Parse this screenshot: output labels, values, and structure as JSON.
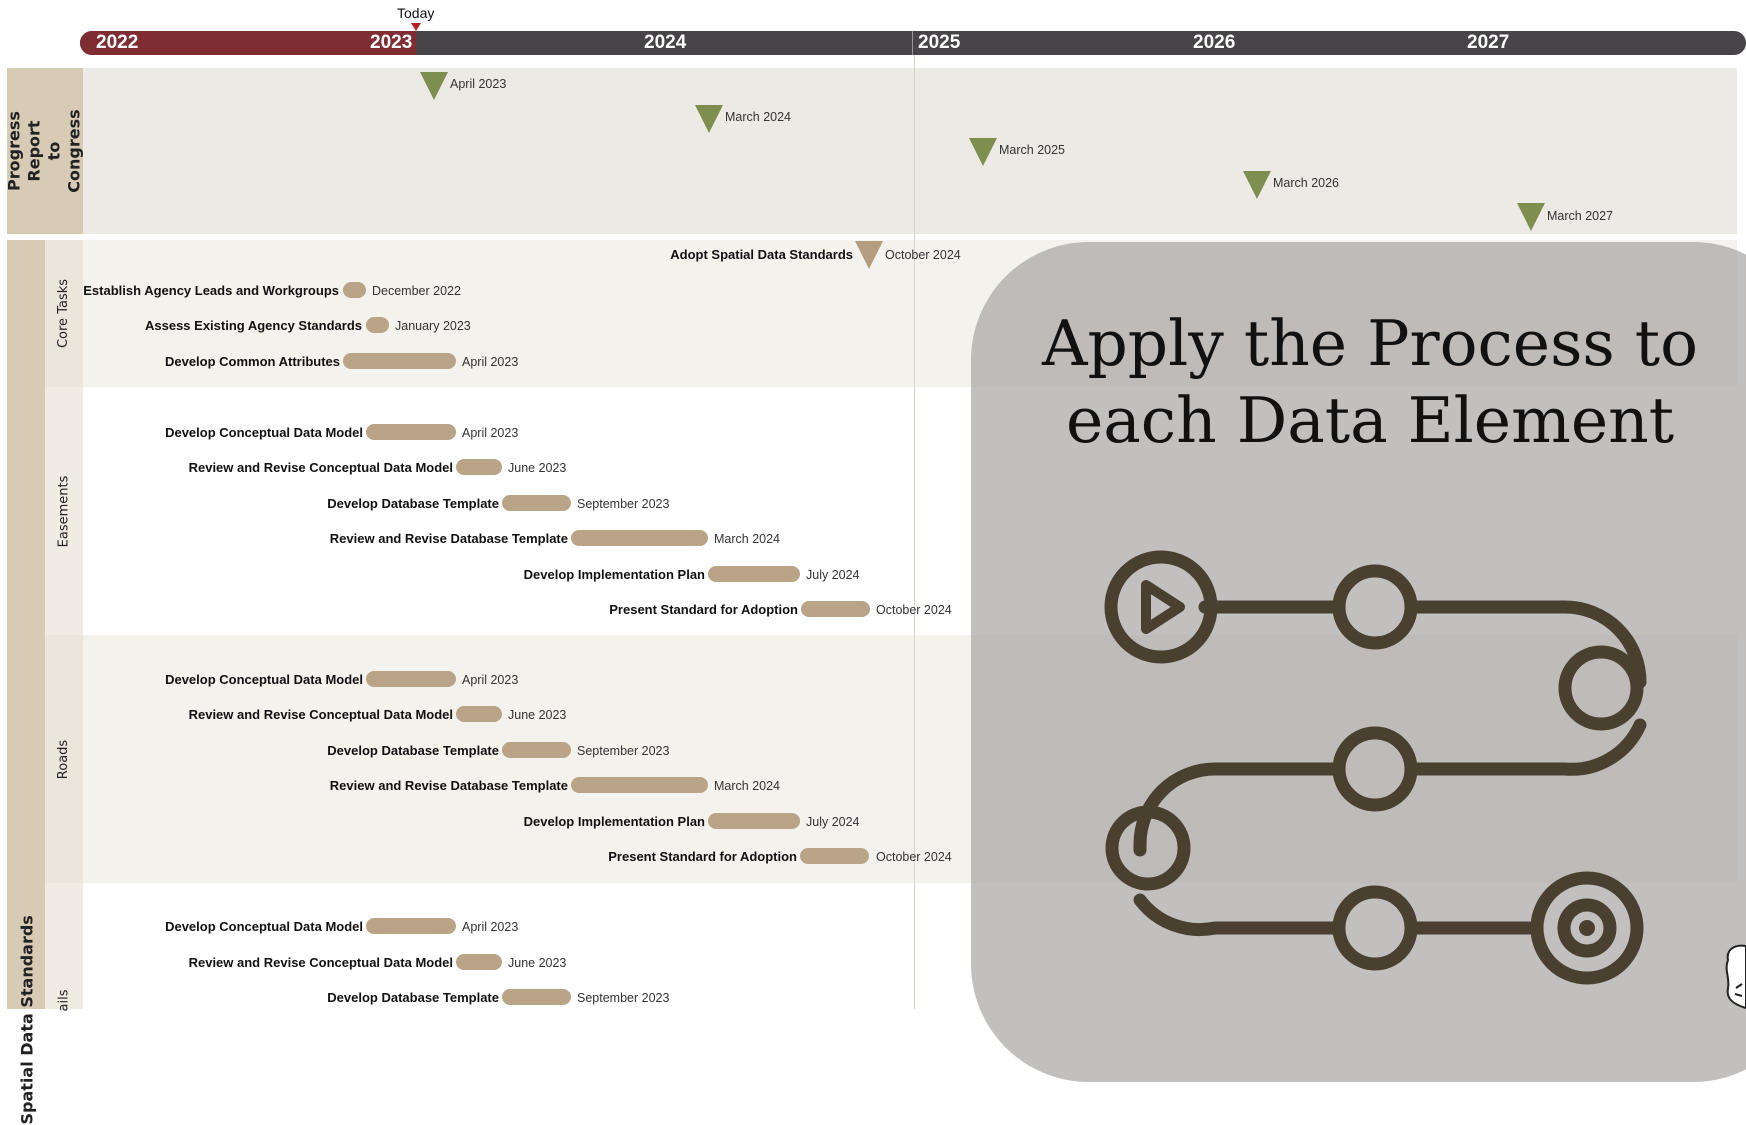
{
  "today": {
    "label": "Today"
  },
  "timeline": {
    "years": [
      "2022",
      "2023",
      "2024",
      "2025",
      "2026",
      "2027"
    ],
    "past_color": "#7f2d33",
    "future_color": "#464446"
  },
  "lanes": {
    "progress_report": {
      "label": "Progress Report to Congress",
      "milestones": [
        {
          "date": "April 2023"
        },
        {
          "date": "March 2024"
        },
        {
          "date": "March 2025"
        },
        {
          "date": "March 2026"
        },
        {
          "date": "March 2027"
        }
      ]
    },
    "spatial_data_standards": {
      "label": "Spatial Data Standards",
      "core_tasks": {
        "label": "Core Tasks",
        "milestone": {
          "name": "Adopt Spatial Data Standards",
          "date": "October 2024"
        },
        "tasks": [
          {
            "name": "Establish Agency Leads and Workgroups",
            "date": "December 2022"
          },
          {
            "name": "Assess Existing Agency Standards",
            "date": "January 2023"
          },
          {
            "name": "Develop Common Attributes",
            "date": "April 2023"
          }
        ]
      },
      "easements": {
        "label": "Easements",
        "tasks": [
          {
            "name": "Develop Conceptual Data Model",
            "date": "April 2023"
          },
          {
            "name": "Review and Revise Conceptual Data Model",
            "date": "June 2023"
          },
          {
            "name": "Develop Database Template",
            "date": "September 2023"
          },
          {
            "name": "Review and Revise Database Template",
            "date": "March 2024"
          },
          {
            "name": "Develop Implementation Plan",
            "date": "July 2024"
          },
          {
            "name": "Present Standard for Adoption",
            "date": "October 2024"
          }
        ]
      },
      "roads": {
        "label": "Roads",
        "tasks": [
          {
            "name": "Develop Conceptual Data Model",
            "date": "April 2023"
          },
          {
            "name": "Review and Revise Conceptual Data Model",
            "date": "June 2023"
          },
          {
            "name": "Develop Database Template",
            "date": "September 2023"
          },
          {
            "name": "Review and Revise Database Template",
            "date": "March 2024"
          },
          {
            "name": "Develop Implementation Plan",
            "date": "July 2024"
          },
          {
            "name": "Present Standard for Adoption",
            "date": "October 2024"
          }
        ]
      },
      "trails": {
        "label": "ails",
        "tasks": [
          {
            "name": "Develop Conceptual Data Model",
            "date": "April 2023"
          },
          {
            "name": "Review and Revise Conceptual Data Model",
            "date": "June 2023"
          },
          {
            "name": "Develop Database Template",
            "date": "September 2023"
          }
        ]
      }
    }
  },
  "overlay": {
    "title_line1": "Apply the Process to",
    "title_line2": "each Data Element",
    "icon": "process-path-icon",
    "icon_color": "#4a4030"
  }
}
